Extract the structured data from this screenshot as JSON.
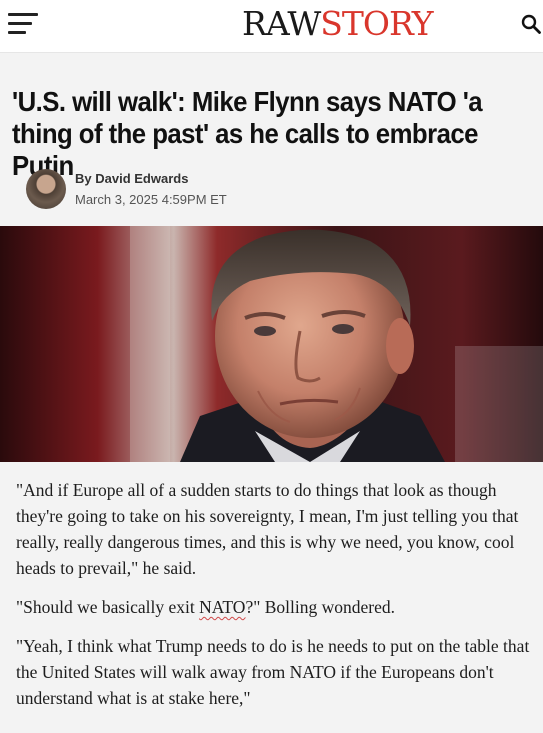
{
  "header": {
    "logo_part1": "RAW",
    "logo_part2": "STORY",
    "menu_icon": "hamburger-menu-icon",
    "search_icon": "search-icon",
    "colors": {
      "logo_accent": "#d9362c",
      "logo_dark": "#1a1a1a"
    }
  },
  "article": {
    "headline": "'U.S. will walk': Mike Flynn says NATO 'a thing of the past' as he calls to embrace Putin",
    "author": "By David Edwards",
    "date": "March 3, 2025 4:59PM ET",
    "paragraph1": "\"And if Europe all of a sudden starts to do things that look as though they're going to take on his sovereignty, I mean, I'm just telling you that really, really dangerous times, and this is why we need, you know, cool heads to prevail,\" he said.",
    "paragraph2_pre": "\"Should we basically exit ",
    "paragraph2_flagged": "NATO",
    "paragraph2_post": "?\" Bolling wondered.",
    "paragraph3": "\"Yeah, I think what Trump needs to do is he needs to put on the table that the United States will walk away from NATO if the Europeans don't understand what is at stake here,\""
  }
}
